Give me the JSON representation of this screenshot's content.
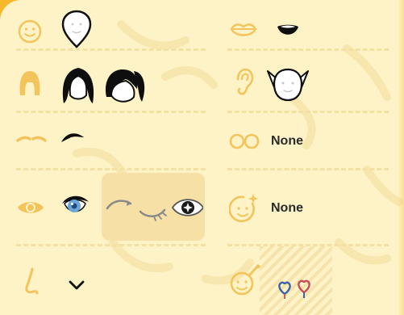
{
  "screen": "avatar-face-customizer",
  "colors": {
    "background_accent": "#f7b82c",
    "panel": "#fdf3c6",
    "category_icon": "#f3c45c",
    "selected_cell": "#f6e0a6",
    "ink": "#111111",
    "eye_blue": "#6aa6db"
  },
  "rows": [
    {
      "category": "face-shape",
      "options": [
        "face-shape-option"
      ]
    },
    {
      "category": "hair",
      "options": [
        "hair-long-option",
        "hair-ponytail-option"
      ]
    },
    {
      "category": "eyebrows",
      "options": [
        "eyebrow-arch-option"
      ]
    },
    {
      "category": "eyes",
      "options": [
        "eye-blue-option",
        "eye-selected-group"
      ]
    },
    {
      "category": "nose",
      "options": [
        "nose-option"
      ]
    }
  ],
  "right_rows": [
    {
      "category": "mouth",
      "options": [
        "mouth-open-smile-option"
      ]
    },
    {
      "category": "ears",
      "options": [
        "ears-pointed-option"
      ]
    },
    {
      "category": "glasses",
      "value_label": "None"
    },
    {
      "category": "face-sparkles",
      "value_label": "None"
    },
    {
      "category": "face-paint",
      "options": [
        "heart-earring-option"
      ]
    }
  ]
}
